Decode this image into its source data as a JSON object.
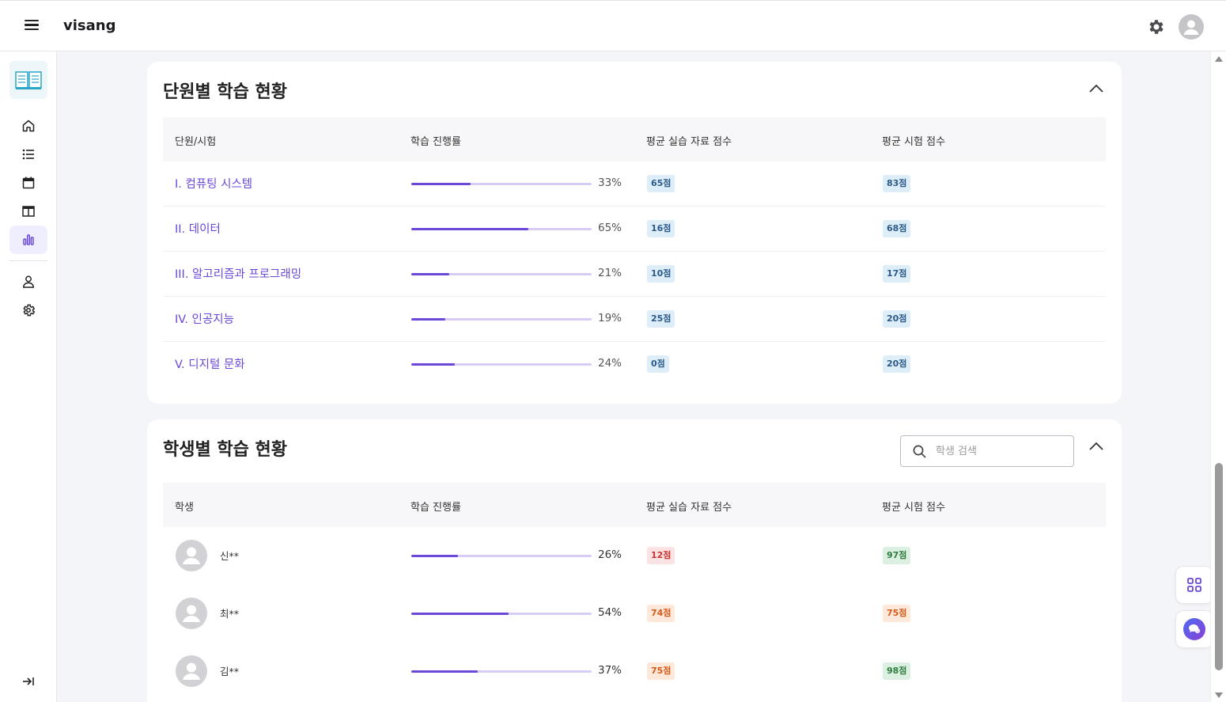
{
  "header": {
    "brand": "visang"
  },
  "sidebar": {
    "items": [
      {
        "name": "home-icon"
      },
      {
        "name": "list-icon"
      },
      {
        "name": "calendar-icon"
      },
      {
        "name": "layout-icon"
      },
      {
        "name": "chart-icon",
        "active": true
      },
      {
        "name": "user-icon"
      },
      {
        "name": "settings-icon"
      }
    ]
  },
  "units_section": {
    "title": "단원별 학습 현황",
    "columns": [
      "단원/시험",
      "학습 진행률",
      "평균 실습 자료 점수",
      "평균 시험 점수"
    ],
    "rows": [
      {
        "name": "I. 컴퓨팅 시스템",
        "progress": 33,
        "progress_label": "33%",
        "practice": "65점",
        "exam": "83점"
      },
      {
        "name": "II. 데이터",
        "progress": 65,
        "progress_label": "65%",
        "practice": "16점",
        "exam": "68점"
      },
      {
        "name": "III. 알고리즘과 프로그래밍",
        "progress": 21,
        "progress_label": "21%",
        "practice": "10점",
        "exam": "17점"
      },
      {
        "name": "IV. 인공지능",
        "progress": 19,
        "progress_label": "19%",
        "practice": "25점",
        "exam": "20점"
      },
      {
        "name": "V. 디지털 문화",
        "progress": 24,
        "progress_label": "24%",
        "practice": "0점",
        "exam": "20점"
      }
    ]
  },
  "students_section": {
    "title": "학생별 학습 현황",
    "search_placeholder": "학생 검색",
    "columns": [
      "학생",
      "학습 진행률",
      "평균 실습 자료 점수",
      "평균 시험 점수"
    ],
    "rows": [
      {
        "name": "신**",
        "progress": 26,
        "progress_label": "26%",
        "practice": "12점",
        "practice_tone": "red",
        "exam": "97점",
        "exam_tone": "green"
      },
      {
        "name": "최**",
        "progress": 54,
        "progress_label": "54%",
        "practice": "74점",
        "practice_tone": "orange",
        "exam": "75점",
        "exam_tone": "orange"
      },
      {
        "name": "김**",
        "progress": 37,
        "progress_label": "37%",
        "practice": "75점",
        "practice_tone": "orange",
        "exam": "98점",
        "exam_tone": "green"
      }
    ]
  },
  "colors": {
    "accent": "#6b48d8",
    "accent_light": "#d6ccf5",
    "badge_blue_bg": "#deeef8",
    "badge_red_bg": "#fbe3e3",
    "badge_orange_bg": "#fde8da",
    "badge_green_bg": "#dcf0e1"
  }
}
